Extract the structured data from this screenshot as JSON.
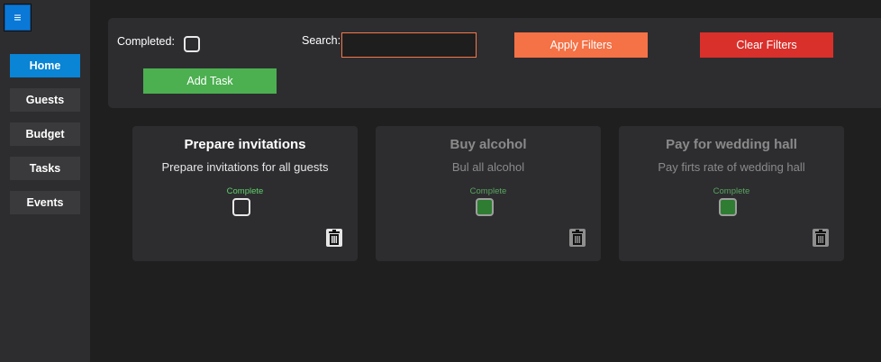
{
  "sidebar": {
    "menu_icon": "hamburger-icon",
    "menu_glyph": "≡",
    "items": [
      {
        "label": "Home"
      },
      {
        "label": "Guests"
      },
      {
        "label": "Budget"
      },
      {
        "label": "Tasks"
      },
      {
        "label": "Events"
      }
    ]
  },
  "filters": {
    "completed_label": "Completed:",
    "search_label": "Search:",
    "search_value": "",
    "apply_label": "Apply Filters",
    "clear_label": "Clear Filters",
    "add_label": "Add Task"
  },
  "tasks": [
    {
      "title": "Prepare invitations",
      "description": "Prepare invitations for all guests",
      "complete_label": "Complete",
      "completed": false
    },
    {
      "title": "Buy alcohol",
      "description": "Bul all alcohol",
      "complete_label": "Complete",
      "completed": true
    },
    {
      "title": "Pay for wedding hall",
      "description": "Pay firts rate of wedding hall",
      "complete_label": "Complete",
      "completed": true
    }
  ],
  "colors": {
    "accent_blue": "#0a84d4",
    "apply_orange": "#f57146",
    "clear_red": "#d9302b",
    "add_green": "#4caf50",
    "complete_green": "#2e7d32"
  }
}
